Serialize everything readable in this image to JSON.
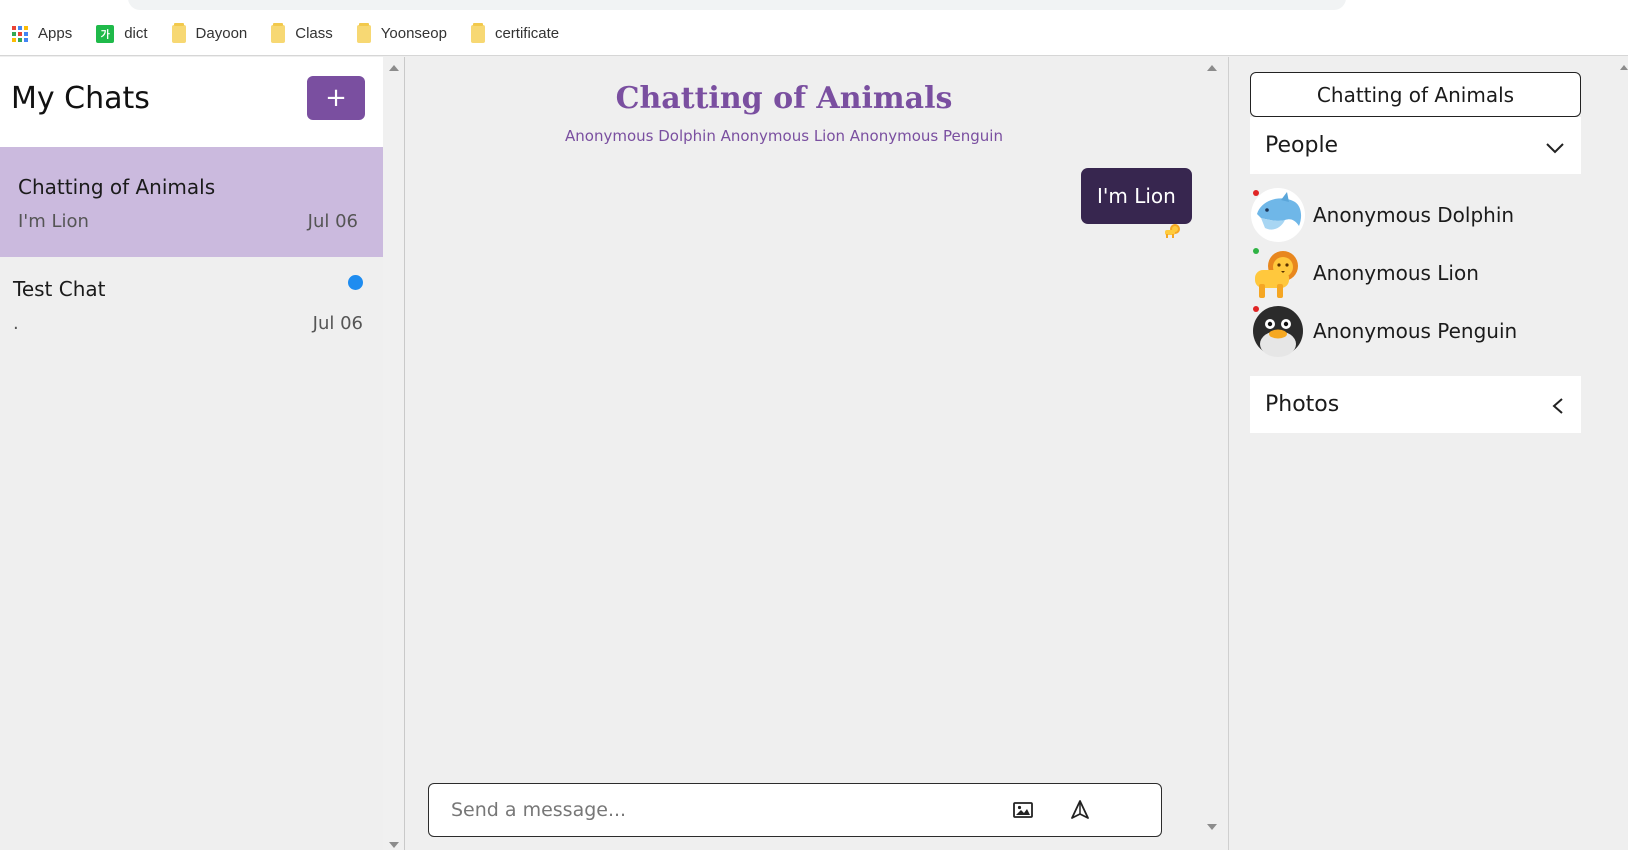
{
  "bookmarks": {
    "items": [
      {
        "label": "Apps",
        "icon": "apps-grid-icon"
      },
      {
        "label": "dict",
        "icon": "dict-icon"
      },
      {
        "label": "Dayoon",
        "icon": "folder-icon"
      },
      {
        "label": "Class",
        "icon": "folder-icon"
      },
      {
        "label": "Yoonseop",
        "icon": "folder-icon"
      },
      {
        "label": "certificate",
        "icon": "folder-icon"
      }
    ]
  },
  "sidebar": {
    "title": "My Chats",
    "add_label": "+",
    "chats": [
      {
        "title": "Chatting of Animals",
        "last_message": "I'm Lion",
        "date": "Jul 06",
        "active": true,
        "unread": false
      },
      {
        "title": "Test Chat",
        "last_message": ".",
        "date": "Jul 06",
        "active": false,
        "unread": true
      }
    ]
  },
  "chat": {
    "title": "Chatting of Animals",
    "members": "Anonymous Dolphin Anonymous Lion Anonymous Penguin",
    "messages": [
      {
        "text": "I'm Lion",
        "sender": "Anonymous Lion",
        "sender_icon": "lion-icon"
      }
    ],
    "composer": {
      "placeholder": "Send a message...",
      "value": ""
    }
  },
  "details": {
    "chat_name": "Chatting of Animals",
    "people_label": "People",
    "photos_label": "Photos",
    "people": [
      {
        "name": "Anonymous Dolphin",
        "icon": "dolphin-icon",
        "status_color": "#e02424"
      },
      {
        "name": "Anonymous Lion",
        "icon": "lion-icon",
        "status_color": "#2fb344"
      },
      {
        "name": "Anonymous Penguin",
        "icon": "penguin-icon",
        "status_color": "#e02424"
      }
    ]
  },
  "colors": {
    "accent": "#7a4fa0",
    "active_chat_bg": "#cbbade",
    "bubble_bg": "#37264f",
    "unread_dot": "#1e8cf0"
  }
}
